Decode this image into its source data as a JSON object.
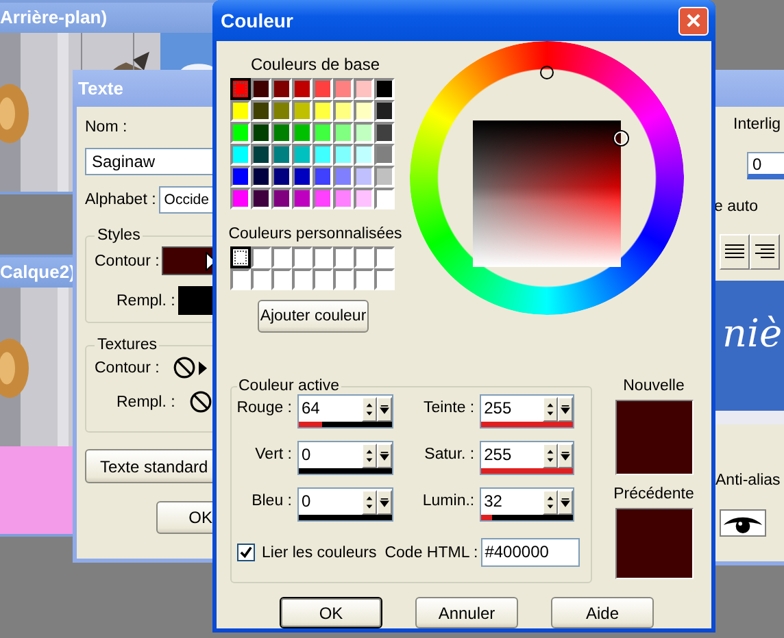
{
  "image_windows": [
    {
      "title": "Arrière-plan)"
    },
    {
      "title": "Calque2)",
      "kind": "photo_with_layer"
    }
  ],
  "text_dialog": {
    "title": "Texte",
    "name_label": "Nom :",
    "name_value": "Saginaw",
    "alphabet_label": "Alphabet :",
    "alphabet_value": "Occide",
    "styles": {
      "title": "Styles",
      "outline_label": "Contour :",
      "fill_label": "Rempl. :"
    },
    "textures": {
      "title": "Textures",
      "outline_label": "Contour :",
      "fill_label": "Rempl. :"
    },
    "standard_button": "Texte standard",
    "ok_button": "OK"
  },
  "side_window": {
    "line_spacing_label": "Interlig",
    "line_spacing_value": "0",
    "auto_label": "e auto",
    "preview_text": "niè",
    "antialias_label": "Anti-alias"
  },
  "color_dialog": {
    "title": "Couleur",
    "base_colors_label": "Couleurs de base",
    "base_colors": [
      {
        "color": "#ff0000",
        "selected": true
      },
      {
        "color": "#400000",
        "selected": false
      },
      {
        "color": "#800000",
        "selected": false
      },
      {
        "color": "#c00000",
        "selected": false
      },
      {
        "color": "#ff4040",
        "selected": false
      },
      {
        "color": "#ff8080",
        "selected": false
      },
      {
        "color": "#ffc0c0",
        "selected": false
      },
      {
        "color": "#000000",
        "selected": false
      },
      {
        "color": "#ffff00",
        "selected": false
      },
      {
        "color": "#404000",
        "selected": false
      },
      {
        "color": "#808000",
        "selected": false
      },
      {
        "color": "#c0c000",
        "selected": false
      },
      {
        "color": "#ffff40",
        "selected": false
      },
      {
        "color": "#ffff80",
        "selected": false
      },
      {
        "color": "#ffffc0",
        "selected": false
      },
      {
        "color": "#202020",
        "selected": false
      },
      {
        "color": "#00ff00",
        "selected": false
      },
      {
        "color": "#004000",
        "selected": false
      },
      {
        "color": "#008000",
        "selected": false
      },
      {
        "color": "#00c000",
        "selected": false
      },
      {
        "color": "#40ff40",
        "selected": false
      },
      {
        "color": "#80ff80",
        "selected": false
      },
      {
        "color": "#c0ffc0",
        "selected": false
      },
      {
        "color": "#404040",
        "selected": false
      },
      {
        "color": "#00ffff",
        "selected": false
      },
      {
        "color": "#004040",
        "selected": false
      },
      {
        "color": "#008080",
        "selected": false
      },
      {
        "color": "#00c0c0",
        "selected": false
      },
      {
        "color": "#40ffff",
        "selected": false
      },
      {
        "color": "#80ffff",
        "selected": false
      },
      {
        "color": "#c0ffff",
        "selected": false
      },
      {
        "color": "#808080",
        "selected": false
      },
      {
        "color": "#0000ff",
        "selected": false
      },
      {
        "color": "#000040",
        "selected": false
      },
      {
        "color": "#000080",
        "selected": false
      },
      {
        "color": "#0000c0",
        "selected": false
      },
      {
        "color": "#4040ff",
        "selected": false
      },
      {
        "color": "#8080ff",
        "selected": false
      },
      {
        "color": "#c0c0ff",
        "selected": false
      },
      {
        "color": "#c0c0c0",
        "selected": false
      },
      {
        "color": "#ff00ff",
        "selected": false
      },
      {
        "color": "#400040",
        "selected": false
      },
      {
        "color": "#800080",
        "selected": false
      },
      {
        "color": "#c000c0",
        "selected": false
      },
      {
        "color": "#ff40ff",
        "selected": false
      },
      {
        "color": "#ff80ff",
        "selected": false
      },
      {
        "color": "#ffc0ff",
        "selected": false
      },
      {
        "color": "#ffffff",
        "selected": false
      }
    ],
    "custom_colors_label": "Couleurs personnalisées",
    "custom_colors": [
      {
        "color": "#ffffff",
        "selected": true
      },
      {
        "color": "#ffffff",
        "selected": false
      },
      {
        "color": "#ffffff",
        "selected": false
      },
      {
        "color": "#ffffff",
        "selected": false
      },
      {
        "color": "#ffffff",
        "selected": false
      },
      {
        "color": "#ffffff",
        "selected": false
      },
      {
        "color": "#ffffff",
        "selected": false
      },
      {
        "color": "#ffffff",
        "selected": false
      },
      {
        "color": "#ffffff",
        "selected": false
      },
      {
        "color": "#ffffff",
        "selected": false
      },
      {
        "color": "#ffffff",
        "selected": false
      },
      {
        "color": "#ffffff",
        "selected": false
      },
      {
        "color": "#ffffff",
        "selected": false
      },
      {
        "color": "#ffffff",
        "selected": false
      },
      {
        "color": "#ffffff",
        "selected": false
      },
      {
        "color": "#ffffff",
        "selected": false
      }
    ],
    "add_color_button": "Ajouter couleur",
    "active_color_label": "Couleur active",
    "fields": [
      {
        "label": "Rouge :",
        "value": "64",
        "level": 0.25
      },
      {
        "label": "Teinte :",
        "value": "255",
        "level": 1
      },
      {
        "label": "Vert :",
        "value": "0",
        "level": 0
      },
      {
        "label": "Satur. :",
        "value": "255",
        "level": 1
      },
      {
        "label": "Bleu :",
        "value": "0",
        "level": 0
      },
      {
        "label": "Lumin.:",
        "value": "32",
        "level": 0.125
      }
    ],
    "link_colors": {
      "label": "Lier les couleurs",
      "checked": true
    },
    "html_code_label": "Code HTML :",
    "html_code_value": "#400000",
    "new_label": "Nouvelle",
    "previous_label": "Précédente",
    "buttons": [
      "OK",
      "Annuler",
      "Aide"
    ]
  }
}
